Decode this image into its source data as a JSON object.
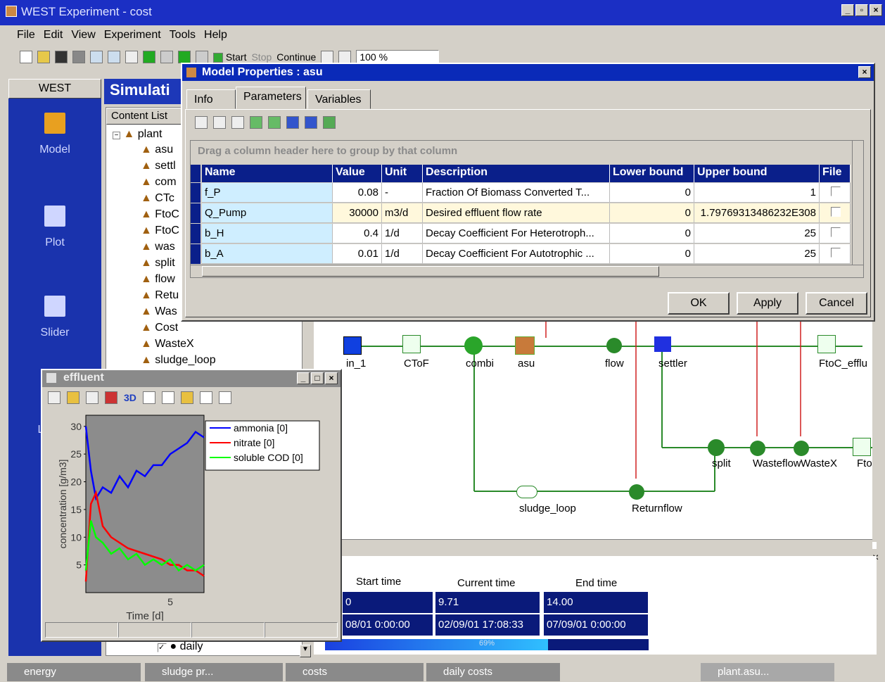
{
  "app": {
    "title": "WEST Experiment - cost"
  },
  "menu": [
    "File",
    "Edit",
    "View",
    "Experiment",
    "Tools",
    "Help"
  ],
  "toolbar": {
    "start": "Start",
    "stop": "Stop",
    "continue": "Continue",
    "zoom": "100 %"
  },
  "west": {
    "header": "WEST",
    "nav": [
      "Model",
      "Plot",
      "Slider",
      "L"
    ]
  },
  "sim": {
    "header": "Simulati",
    "content_list": "Content List"
  },
  "tree": {
    "root": "plant",
    "items": [
      "asu",
      "settl",
      "com",
      "CTc",
      "FtoC",
      "FtoC",
      "was",
      "split",
      "flow",
      "Retu",
      "Was",
      "Cost",
      "WasteX",
      "sludge_loop"
    ],
    "bottom_item": "daily"
  },
  "dialog": {
    "title": "Model Properties : asu",
    "tabs": [
      "Info",
      "Parameters",
      "Variables"
    ],
    "group_hint": "Drag a column header here to group by that column",
    "columns": [
      "Name",
      "Value",
      "Unit",
      "Description",
      "Lower bound",
      "Upper bound",
      "File"
    ],
    "rows": [
      {
        "name": "f_P",
        "value": "0.08",
        "unit": "-",
        "desc": "Fraction Of Biomass Converted T...",
        "lower": "0",
        "upper": "1"
      },
      {
        "name": "Q_Pump",
        "value": "30000",
        "unit": "m3/d",
        "desc": "Desired effluent flow rate",
        "lower": "0",
        "upper": "1.79769313486232E308"
      },
      {
        "name": "b_H",
        "value": "0.4",
        "unit": "1/d",
        "desc": "Decay Coefficient For Heterotroph...",
        "lower": "0",
        "upper": "25"
      },
      {
        "name": "b_A",
        "value": "0.01",
        "unit": "1/d",
        "desc": "Decay Coefficient For Autotrophic ...",
        "lower": "0",
        "upper": "25"
      }
    ],
    "ok": "OK",
    "apply": "Apply",
    "cancel": "Cancel"
  },
  "model_blocks": {
    "in_1": "in_1",
    "ctof": "CToF",
    "combi": "combi",
    "asu": "asu",
    "flow": "flow",
    "settler": "settler",
    "ftoc": "FtoC_efflu",
    "split": "split",
    "wasteflow": "Wasteflow",
    "wastex": "WasteX",
    "fto": "Fto",
    "sludge_loop": "sludge_loop",
    "returnflow": "Returnflow"
  },
  "plot": {
    "title": "effluent",
    "btn3d": "3D"
  },
  "timing": {
    "headers": [
      "Start time",
      "Current time",
      "End time"
    ],
    "values": [
      "0",
      "9.71",
      "14.00"
    ],
    "dates": [
      "08/01 0:00:00",
      "02/09/01 17:08:33",
      "07/09/01 0:00:00"
    ],
    "progress": 0.69,
    "progress_label": "69%"
  },
  "taskbar": [
    "energy",
    "sludge pr...",
    "costs",
    "daily costs",
    "plant.asu..."
  ],
  "chart_data": {
    "type": "line",
    "title": "",
    "xlabel": "Time [d]",
    "ylabel": "concentration [g/m3]",
    "xlim": [
      0,
      7
    ],
    "ylim": [
      0,
      32
    ],
    "xticks": [
      5
    ],
    "yticks": [
      5,
      10,
      15,
      20,
      25,
      30
    ],
    "legend_position": "top-right",
    "series": [
      {
        "name": "ammonia [0]",
        "color": "#0000ff",
        "x": [
          0,
          0.3,
          0.6,
          1,
          1.5,
          2,
          2.5,
          3,
          3.5,
          4,
          4.5,
          5,
          5.5,
          6,
          6.5,
          7
        ],
        "y": [
          30,
          22,
          17,
          19,
          18,
          21,
          19,
          22,
          21,
          23,
          23,
          25,
          26,
          27,
          29,
          28
        ]
      },
      {
        "name": "nitrate [0]",
        "color": "#ff0000",
        "x": [
          0,
          0.3,
          0.6,
          1,
          1.5,
          2,
          2.5,
          3,
          3.5,
          4,
          4.5,
          5,
          5.5,
          6,
          6.5,
          7
        ],
        "y": [
          2,
          16,
          18,
          12,
          10,
          9,
          8,
          7.5,
          7,
          6.5,
          6,
          5,
          5,
          4,
          4,
          3
        ]
      },
      {
        "name": "soluble COD [0]",
        "color": "#00ff00",
        "x": [
          0,
          0.3,
          0.6,
          1,
          1.5,
          2,
          2.5,
          3,
          3.5,
          4,
          4.5,
          5,
          5.5,
          6,
          6.5,
          7
        ],
        "y": [
          4,
          13,
          10,
          9,
          7,
          8,
          6,
          7,
          5,
          6,
          5,
          6,
          4,
          5,
          4,
          5
        ]
      }
    ]
  }
}
